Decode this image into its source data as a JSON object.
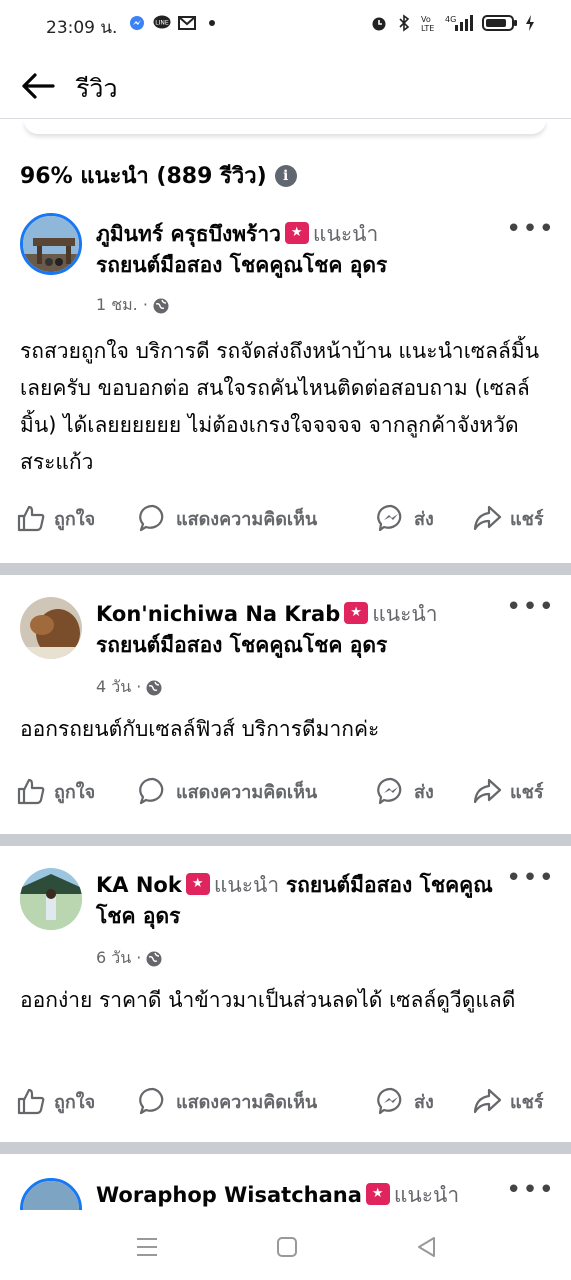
{
  "status_bar": {
    "time": "23:09 น.",
    "left_icons": [
      "messenger-icon",
      "line-icon",
      "gmail-icon",
      "dot-icon"
    ],
    "right_icons": [
      "alarm-icon",
      "bluetooth-icon",
      "volte-icon",
      "signal-4g-icon",
      "battery-icon",
      "charging-icon"
    ]
  },
  "header": {
    "title": "รีวิว"
  },
  "summary": {
    "text": "96% แนะนำ (889 รีวิว)"
  },
  "reviews": [
    {
      "author": "ภูมินทร์ ครุธบึงพร้าว",
      "recommends": "แนะนำ",
      "page": "รถยนต์มือสอง โชคคูณโชค อุดร",
      "time": "1 ชม. ·",
      "text": "รถสวยถูกใจ  บริการดี รถจัดส่งถึงหน้าบ้าน แนะนำเซลล์มิ้น เลยครับ ขอบอกต่อ สนใจรถคันไหนติดต่อสอบถาม (เซลล์มิ้น) ได้เลยยยยยย ไม่ต้องเกรงใจจจจจ จากลูกค้าจังหวัดสระแก้ว"
    },
    {
      "author": "Kon'nichiwa Na Krab",
      "recommends": "แนะนำ",
      "page": "รถยนต์มือสอง โชคคูณโชค อุดร",
      "time": "4 วัน ·",
      "text": "ออกรถยนต์กับเซลล์ฟิวส์ บริการดีมากค่ะ"
    },
    {
      "author": "KA Nok",
      "recommends": "แนะนำ",
      "page": "รถยนต์มือสอง โชคคูณโชค อุดร",
      "time": "6 วัน ·",
      "text": "ออกง่าย ราคาดี นำข้าวมาเป็นส่วนลดได้ เซลล์ดูวีดูแลดี"
    },
    {
      "author": "Woraphop Wisatchana",
      "recommends": "แนะนำ"
    }
  ],
  "actions": {
    "like": "ถูกใจ",
    "comment": "แสดงความคิดเห็น",
    "send": "ส่ง",
    "share": "แชร์"
  },
  "colors": {
    "secondary_text": "#65676b",
    "divider": "#c9ccd1",
    "badge": "#e0245e"
  }
}
